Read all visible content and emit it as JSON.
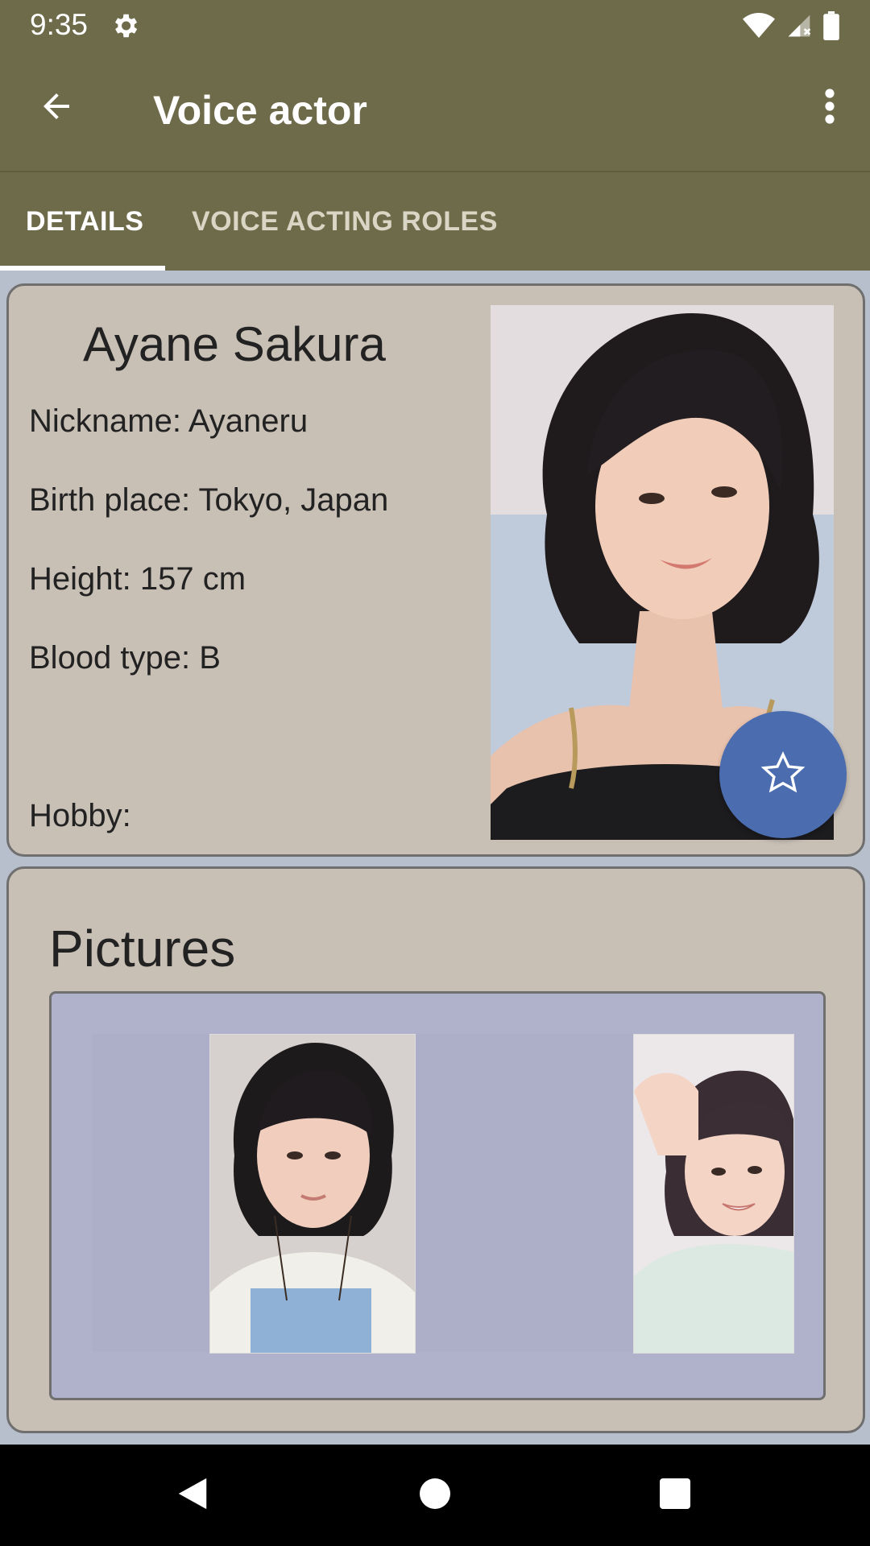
{
  "status_bar": {
    "time": "9:35",
    "icons": [
      "gear-icon",
      "wifi-icon",
      "signal-icon",
      "battery-icon"
    ]
  },
  "app_bar": {
    "title": "Voice actor",
    "back_icon": "arrow-left-icon",
    "menu_icon": "more-vert-icon"
  },
  "tabs": [
    {
      "label": "DETAILS",
      "selected": true
    },
    {
      "label": "VOICE ACTING ROLES",
      "selected": false
    }
  ],
  "details": {
    "name": "Ayane Sakura",
    "nickname": "Nickname: Ayaneru",
    "birth_place": "Birth place: Tokyo, Japan",
    "height": "Height: 157 cm",
    "blood_type": "Blood type: B",
    "hobby": "Hobby:",
    "favorite_icon": "star-outline-icon"
  },
  "pictures": {
    "title": "Pictures",
    "count_visible": 2
  },
  "nav_bar": {
    "icons": [
      "back-triangle-icon",
      "home-circle-icon",
      "recents-square-icon"
    ]
  },
  "colors": {
    "app_bar": "#6e6b4b",
    "card_background": "#c8bfb5",
    "fab": "#4b6db0",
    "gallery_background": "#b0b1cb"
  }
}
